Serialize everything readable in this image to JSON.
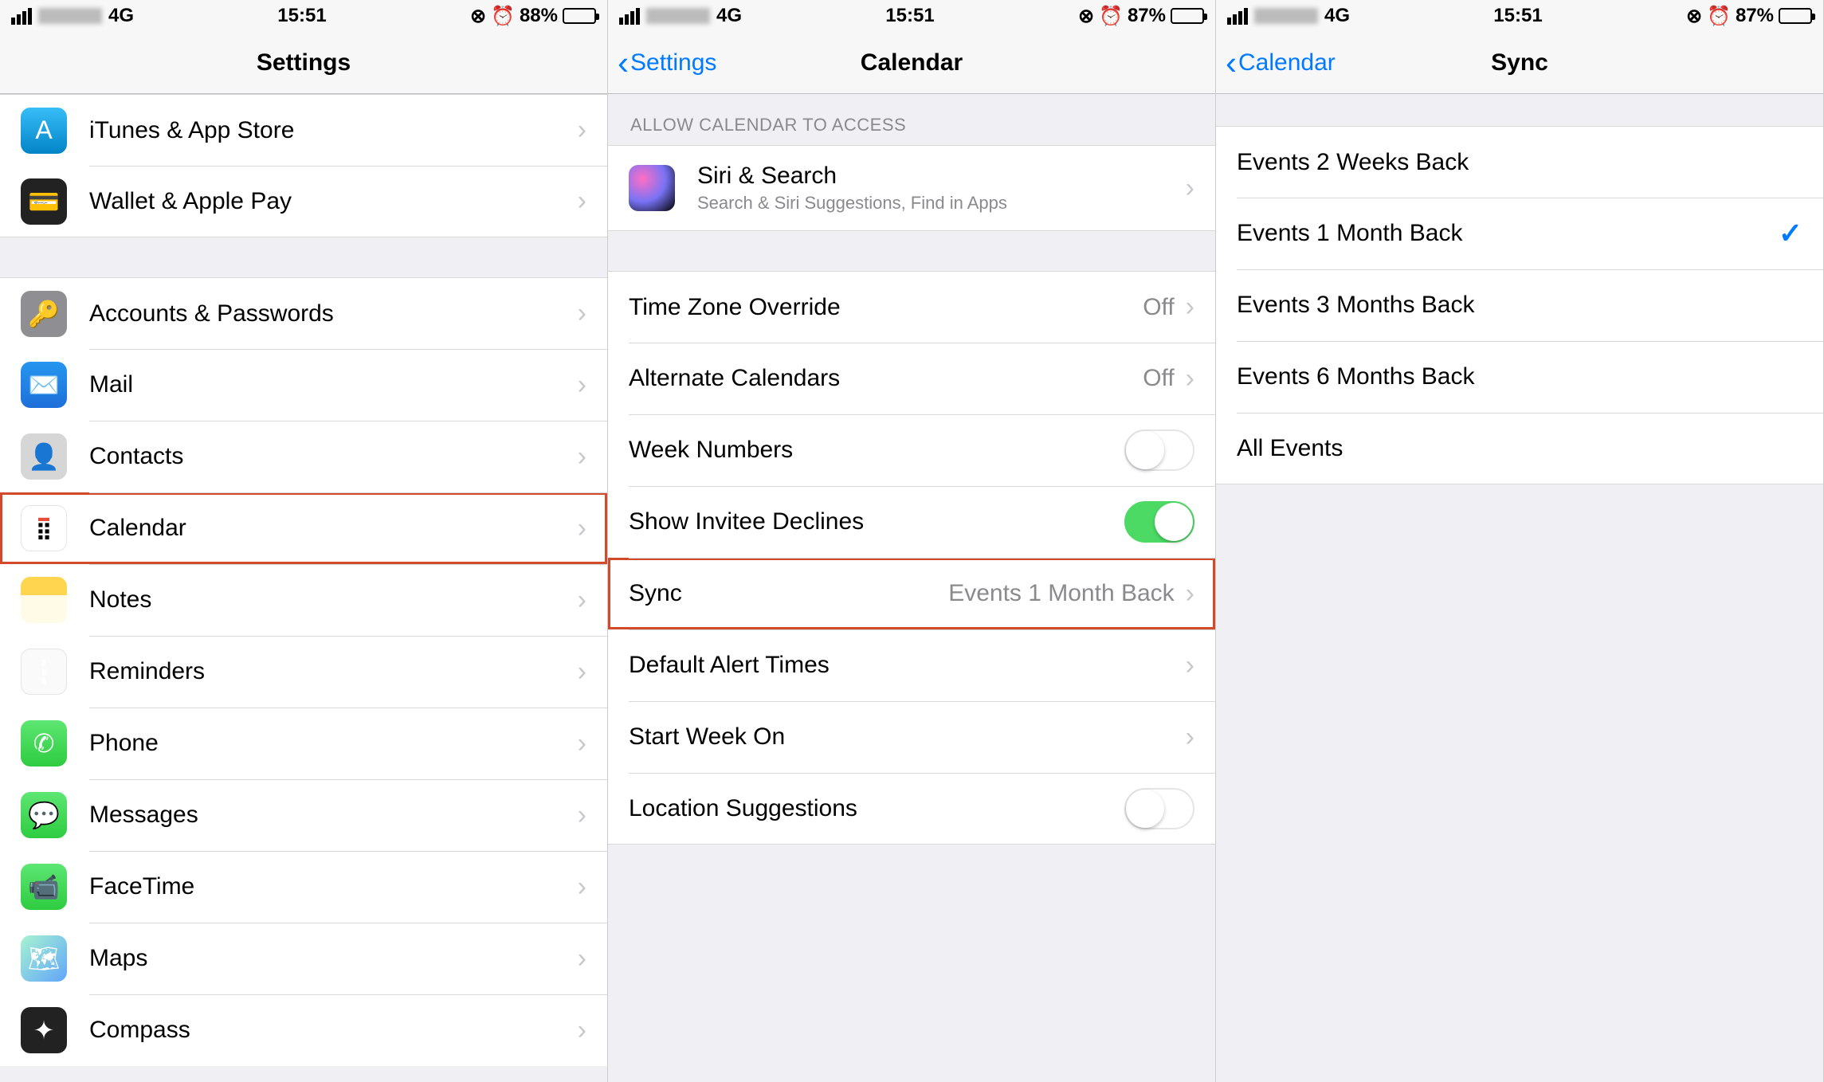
{
  "screen1": {
    "status": {
      "carrier_type": "4G",
      "time": "15:51",
      "battery_pct": "88%"
    },
    "title": "Settings",
    "group1": [
      {
        "icon": "itunes",
        "label": "iTunes & App Store"
      },
      {
        "icon": "wallet",
        "label": "Wallet & Apple Pay"
      }
    ],
    "group2": [
      {
        "icon": "accounts",
        "label": "Accounts & Passwords"
      },
      {
        "icon": "mail",
        "label": "Mail"
      },
      {
        "icon": "contacts",
        "label": "Contacts"
      },
      {
        "icon": "calendar",
        "label": "Calendar",
        "highlight": true
      },
      {
        "icon": "notes",
        "label": "Notes"
      },
      {
        "icon": "reminders",
        "label": "Reminders"
      },
      {
        "icon": "phone",
        "label": "Phone"
      },
      {
        "icon": "messages",
        "label": "Messages"
      },
      {
        "icon": "facetime",
        "label": "FaceTime"
      },
      {
        "icon": "maps",
        "label": "Maps"
      },
      {
        "icon": "compass",
        "label": "Compass"
      }
    ]
  },
  "screen2": {
    "status": {
      "carrier_type": "4G",
      "time": "15:51",
      "battery_pct": "87%"
    },
    "back": "Settings",
    "title": "Calendar",
    "section1_header": "ALLOW CALENDAR TO ACCESS",
    "siri": {
      "title": "Siri & Search",
      "sub": "Search & Siri Suggestions, Find in Apps"
    },
    "rows": [
      {
        "label": "Time Zone Override",
        "type": "detail",
        "detail": "Off"
      },
      {
        "label": "Alternate Calendars",
        "type": "detail",
        "detail": "Off"
      },
      {
        "label": "Week Numbers",
        "type": "toggle",
        "on": false
      },
      {
        "label": "Show Invitee Declines",
        "type": "toggle",
        "on": true
      },
      {
        "label": "Sync",
        "type": "detail",
        "detail": "Events 1 Month Back",
        "highlight": true
      },
      {
        "label": "Default Alert Times",
        "type": "chevron"
      },
      {
        "label": "Start Week On",
        "type": "chevron"
      },
      {
        "label": "Location Suggestions",
        "type": "toggle",
        "on": false
      }
    ]
  },
  "screen3": {
    "status": {
      "carrier_type": "4G",
      "time": "15:51",
      "battery_pct": "87%"
    },
    "back": "Calendar",
    "title": "Sync",
    "options": [
      {
        "label": "Events 2 Weeks Back",
        "selected": false
      },
      {
        "label": "Events 1 Month Back",
        "selected": true
      },
      {
        "label": "Events 3 Months Back",
        "selected": false
      },
      {
        "label": "Events 6 Months Back",
        "selected": false
      },
      {
        "label": "All Events",
        "selected": false
      }
    ]
  }
}
